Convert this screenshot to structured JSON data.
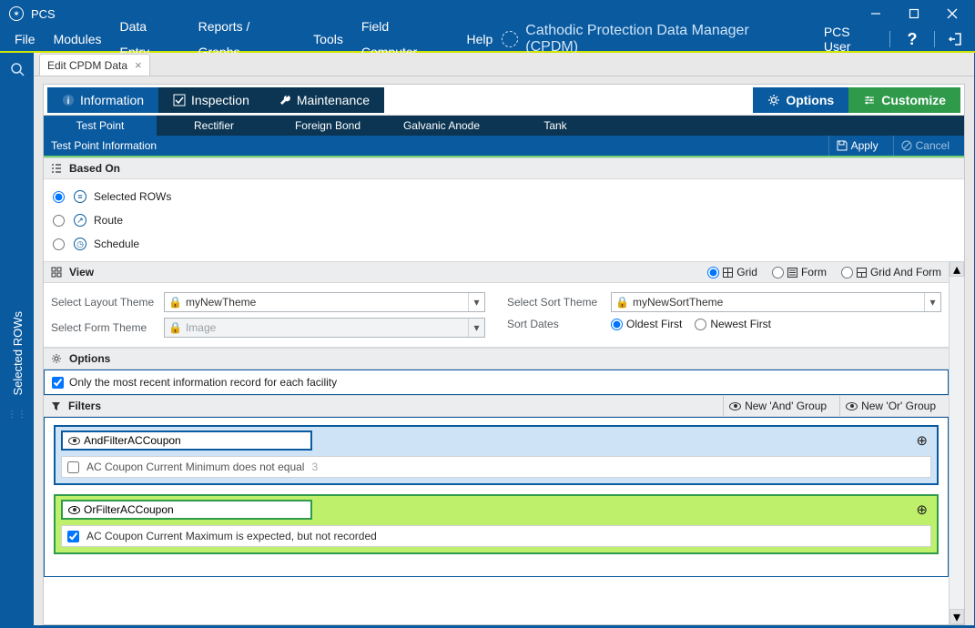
{
  "window": {
    "title": "PCS"
  },
  "menu": {
    "items": [
      "File",
      "Modules",
      "Data Entry",
      "Reports / Graphs",
      "Tools",
      "Field Computer",
      "Help"
    ],
    "appname": "Cathodic Protection Data Manager (CPDM)",
    "user": "PCS User"
  },
  "leftrail": {
    "tab": "Selected ROWs"
  },
  "doctab": {
    "label": "Edit CPDM Data"
  },
  "pills": {
    "information": "Information",
    "inspection": "Inspection",
    "maintenance": "Maintenance",
    "options": "Options",
    "customize": "Customize"
  },
  "subtabs": [
    "Test Point",
    "Rectifier",
    "Foreign Bond",
    "Galvanic Anode",
    "Tank"
  ],
  "bluebar": {
    "title": "Test Point Information",
    "apply": "Apply",
    "cancel": "Cancel"
  },
  "basedon": {
    "header": "Based On",
    "selected_rows": "Selected ROWs",
    "route": "Route",
    "schedule": "Schedule"
  },
  "view": {
    "header": "View",
    "radios": {
      "grid": "Grid",
      "form": "Form",
      "gridform": "Grid And Form"
    },
    "layout_label": "Select Layout Theme",
    "layout_value": "myNewTheme",
    "form_label": "Select Form Theme",
    "form_value": "Image",
    "sort_label": "Select Sort Theme",
    "sort_value": "myNewSortTheme",
    "dates_label": "Sort Dates",
    "oldest": "Oldest First",
    "newest": "Newest First"
  },
  "options": {
    "header": "Options",
    "only_recent": "Only the most recent information record for each facility"
  },
  "filters": {
    "header": "Filters",
    "new_and": "New 'And' Group",
    "new_or": "New 'Or' Group",
    "and_name": "AndFilterACCoupon",
    "and_rule": "AC Coupon Current Minimum does not equal",
    "and_rule_val": "3",
    "or_name": "OrFilterACCoupon",
    "or_rule": "AC Coupon Current Maximum is expected, but not recorded"
  }
}
